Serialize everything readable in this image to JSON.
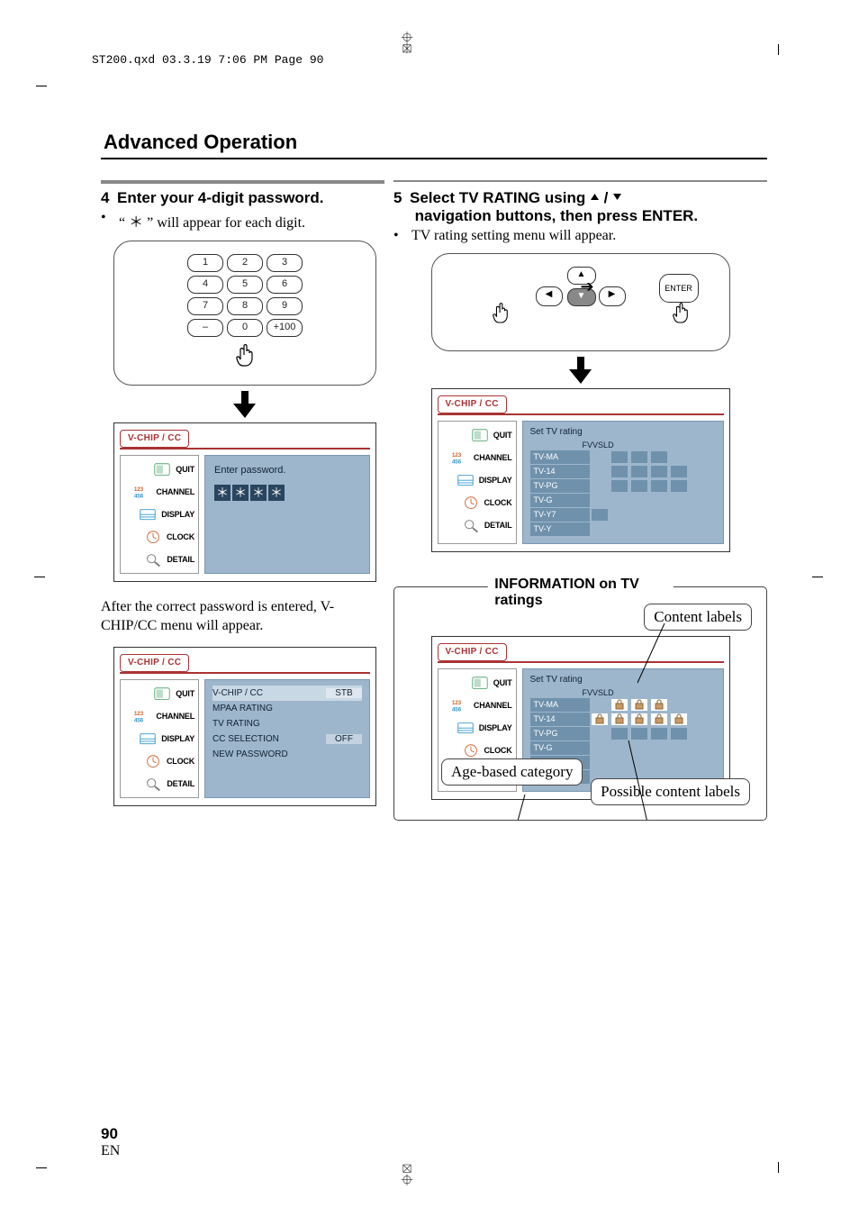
{
  "header": "ST200.qxd  03.3.19 7:06 PM  Page 90",
  "section_title": "Advanced Operation",
  "left": {
    "step_num": "4",
    "step_title": "Enter your 4-digit password.",
    "bullet": "“ ＊ ” will appear for each digit.",
    "keypad": {
      "keys": [
        "1",
        "2",
        "3",
        "4",
        "5",
        "6",
        "7",
        "8",
        "9",
        "–",
        "0",
        "+100"
      ]
    },
    "menu_tab": "V-CHIP / CC",
    "side_items": [
      "QUIT",
      "CHANNEL",
      "DISPLAY",
      "CLOCK",
      "DETAIL"
    ],
    "prompt": "Enter password.",
    "stars": [
      "＊",
      "＊",
      "＊",
      "＊"
    ],
    "after": "After the correct password is entered, V-CHIP/CC menu will appear.",
    "menu2": {
      "items": [
        {
          "name": "V-CHIP / CC",
          "val": "STB"
        },
        {
          "name": "MPAA RATING",
          "val": ""
        },
        {
          "name": "TV RATING",
          "val": ""
        },
        {
          "name": "CC SELECTION",
          "val": "OFF"
        },
        {
          "name": "NEW PASSWORD",
          "val": ""
        }
      ]
    }
  },
  "right": {
    "step_num": "5",
    "step_title_a": "Select TV RATING using ",
    "step_title_b": " navigation buttons, then press ENTER.",
    "bullet": "TV rating setting menu will appear.",
    "enter": "ENTER",
    "menu_tab": "V-CHIP / CC",
    "rating_header": "Set TV rating",
    "cols": [
      "FV",
      "V",
      "S",
      "L",
      "D"
    ],
    "rows": [
      "TV-MA",
      "TV-14",
      "TV-PG",
      "TV-G",
      "TV-Y7",
      "TV-Y"
    ],
    "grid": [
      [
        0,
        1,
        1,
        1,
        0
      ],
      [
        0,
        1,
        1,
        1,
        1
      ],
      [
        0,
        1,
        1,
        1,
        1
      ],
      [
        0,
        0,
        0,
        0,
        0
      ],
      [
        1,
        0,
        0,
        0,
        0
      ],
      [
        0,
        0,
        0,
        0,
        0
      ]
    ],
    "info": {
      "title": "INFORMATION on TV ratings",
      "content_labels": "Content labels",
      "age": "Age-based category",
      "pcl": "Possible content labels",
      "lock_grid": [
        [
          0,
          2,
          2,
          2,
          0
        ],
        [
          2,
          2,
          2,
          2,
          2
        ],
        [
          0,
          1,
          1,
          1,
          1
        ],
        [
          0,
          0,
          0,
          0,
          0
        ],
        [
          0,
          0,
          0,
          0,
          0
        ],
        [
          0,
          0,
          0,
          0,
          0
        ]
      ]
    }
  },
  "page_num": "90",
  "page_lang": "EN"
}
